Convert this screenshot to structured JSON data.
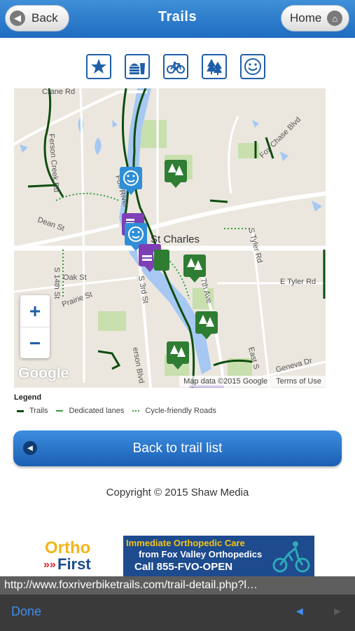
{
  "header": {
    "title": "Trails",
    "back_label": "Back",
    "home_label": "Home"
  },
  "filters": [
    {
      "name": "favorites",
      "icon": "star-icon"
    },
    {
      "name": "food",
      "icon": "food-drink-icon"
    },
    {
      "name": "bike",
      "icon": "bicycle-icon"
    },
    {
      "name": "parks",
      "icon": "trees-icon"
    },
    {
      "name": "fun",
      "icon": "smiley-icon"
    }
  ],
  "map": {
    "labels": {
      "crane": "Crane Rd",
      "ferson": "Ferson Creek Rd",
      "fox_chase": "Fox Chase Blvd",
      "fox_river": "Fox River",
      "st_charles": "St Charles",
      "dean": "Dean St",
      "oak": "Oak St",
      "prairie": "Prairie St",
      "s14": "S 14th St",
      "s3": "S 3rd St",
      "s7": "S 7th Ave",
      "tyler_rd": "S Tyler Rd",
      "e_tyler": "E Tyler Rd",
      "geneva": "Geneva Dr",
      "east_s": "East S",
      "jefferson": "erson Blvd"
    },
    "zoom_in": "+",
    "zoom_out": "−",
    "google": "Google",
    "attribution": "Map data ©2015 Google",
    "terms": "Terms of Use"
  },
  "legend": {
    "title": "Legend",
    "items": [
      {
        "label": "Trails",
        "color": "#0e4d0e"
      },
      {
        "label": "Dedicated lanes",
        "color": "#3a9a3a"
      },
      {
        "label": "Cycle-friendly Roads",
        "color": "#3a9a3a"
      }
    ]
  },
  "back_to_list": "Back to trail list",
  "copyright": "Copyright © 2015 Shaw Media",
  "ad": {
    "brand1": "Ortho",
    "brand2": "First",
    "chevrons": "»»",
    "line1": "Immediate Orthopedic Care",
    "line2": "from Fox Valley Orthopedics",
    "line3": "Call 855-FVO-OPEN"
  },
  "browser": {
    "url": "http://www.foxriverbiketrails.com/trail-detail.php?l…",
    "done": "Done",
    "prev": "◄",
    "next": "►"
  }
}
